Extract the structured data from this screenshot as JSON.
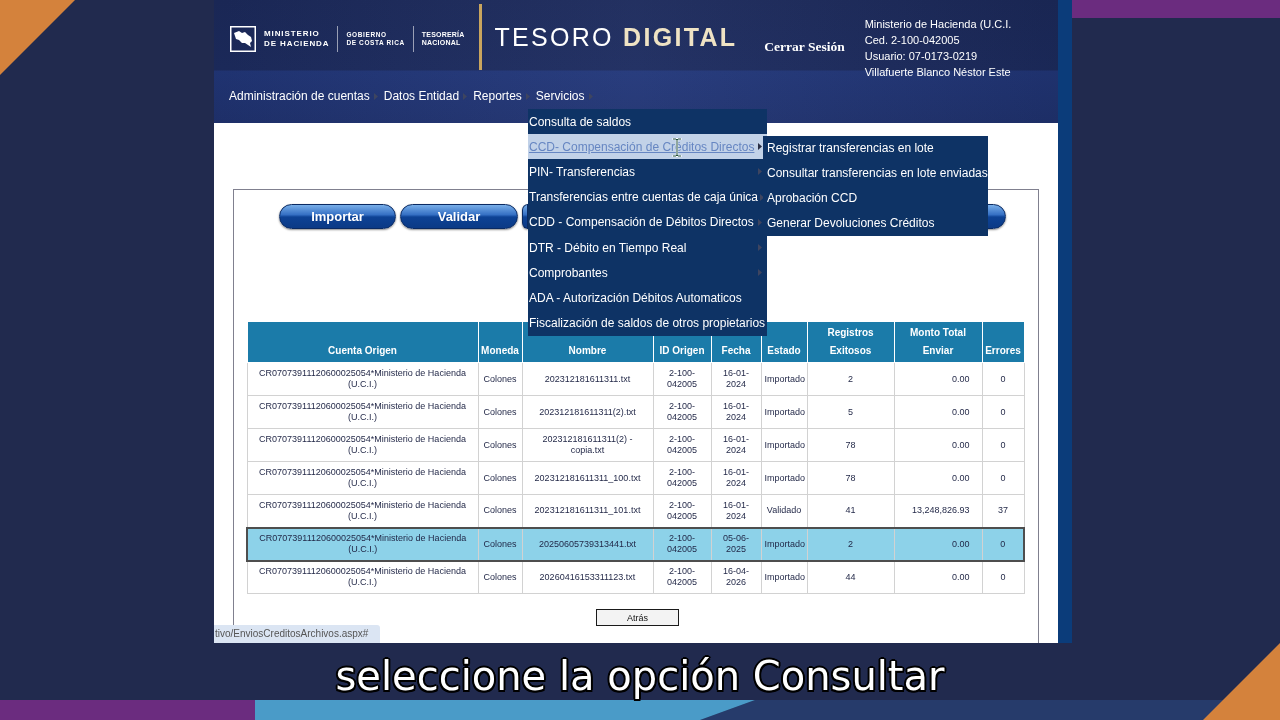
{
  "header": {
    "logo_blocks": [
      [
        "MINISTERIO",
        "DE HACIENDA"
      ],
      [
        "GOBIERNO",
        "DE COSTA RICA"
      ],
      [
        "TESORERÍA",
        "NACIONAL"
      ]
    ],
    "app_title": "TESORO **DIGITAL**",
    "logout_link": "Cerrar Sesión",
    "user_info": [
      "Ministerio de Hacienda (U.C.I.",
      "Ced. 2-100-042005",
      "Usuario: 07-0173-0219",
      "Villafuerte Blanco Néstor Este"
    ]
  },
  "nav": {
    "items": [
      "Administración de cuentas",
      "Datos Entidad",
      "Reportes",
      "Servicios"
    ]
  },
  "dropdown": {
    "items": [
      {
        "label": "Consulta de saldos",
        "has_submenu": false,
        "selected": false
      },
      {
        "label": "CCD- Compensación de Créditos Directos",
        "has_submenu": true,
        "selected": true,
        "submenu": [
          {
            "label": "Registrar transferencias en lote",
            "selected": false
          },
          {
            "label": "Consultar transferencias en lote enviadas",
            "selected": false
          },
          {
            "label": "Aprobación CCD",
            "selected": false
          },
          {
            "label": "Generar Devoluciones Créditos",
            "selected": false
          }
        ]
      },
      {
        "label": "PIN- Transferencias",
        "has_submenu": true,
        "selected": false
      },
      {
        "label": "Transferencias entre cuentas de caja única",
        "has_submenu": true,
        "selected": false
      },
      {
        "label": "CDD - Compensación de Débitos Directos",
        "has_submenu": true,
        "selected": false
      },
      {
        "label": "DTR - Débito en Tiempo Real",
        "has_submenu": true,
        "selected": false
      },
      {
        "label": "Comprobantes",
        "has_submenu": true,
        "selected": false
      },
      {
        "label": "ADA - Autorización Débitos Automaticos",
        "has_submenu": false,
        "selected": false
      },
      {
        "label": "Fiscalización de saldos de otros propietarios",
        "has_submenu": false,
        "selected": false
      }
    ]
  },
  "actions": {
    "buttons": [
      "Importar",
      "Validar"
    ]
  },
  "table": {
    "columns": [
      "Cuenta Origen",
      "Moneda",
      "Nombre",
      "ID Origen",
      "Fecha",
      "Estado",
      "Registros Exitosos",
      "Monto Total Enviar",
      "Errores"
    ],
    "rows": [
      {
        "selected": false,
        "cells": [
          "CR07073911120600025054*Ministerio de Hacienda (U.C.I.)",
          "Colones",
          "202312181611311.txt",
          "2-100-042005",
          "16-01-2024",
          "Importado",
          "2",
          "0.00",
          "0"
        ]
      },
      {
        "selected": false,
        "cells": [
          "CR07073911120600025054*Ministerio de Hacienda (U.C.I.)",
          "Colones",
          "202312181611311(2).txt",
          "2-100-042005",
          "16-01-2024",
          "Importado",
          "5",
          "0.00",
          "0"
        ]
      },
      {
        "selected": false,
        "cells": [
          "CR07073911120600025054*Ministerio de Hacienda (U.C.I.)",
          "Colones",
          "202312181611311(2) - copia.txt",
          "2-100-042005",
          "16-01-2024",
          "Importado",
          "78",
          "0.00",
          "0"
        ]
      },
      {
        "selected": false,
        "cells": [
          "CR07073911120600025054*Ministerio de Hacienda (U.C.I.)",
          "Colones",
          "202312181611311_100.txt",
          "2-100-042005",
          "16-01-2024",
          "Importado",
          "78",
          "0.00",
          "0"
        ]
      },
      {
        "selected": false,
        "cells": [
          "CR07073911120600025054*Ministerio de Hacienda (U.C.I.)",
          "Colones",
          "202312181611311_101.txt",
          "2-100-042005",
          "16-01-2024",
          "Validado",
          "41",
          "13,248,826.93",
          "37"
        ]
      },
      {
        "selected": true,
        "cells": [
          "CR07073911120600025054*Ministerio de Hacienda (U.C.I.)",
          "Colones",
          "20250605739313441.txt",
          "2-100-042005",
          "05-06-2025",
          "Importado",
          "2",
          "0.00",
          "0"
        ]
      },
      {
        "selected": false,
        "cells": [
          "CR07073911120600025054*Ministerio de Hacienda (U.C.I.)",
          "Colones",
          "20260416153311123.txt",
          "2-100-042005",
          "16-04-2026",
          "Importado",
          "44",
          "0.00",
          "0"
        ]
      }
    ]
  },
  "back_button": "Atrás",
  "status_url": "tivo/EnviosCreditosArchivos.aspx#",
  "subtitle": "seleccione la opción Consultar"
}
